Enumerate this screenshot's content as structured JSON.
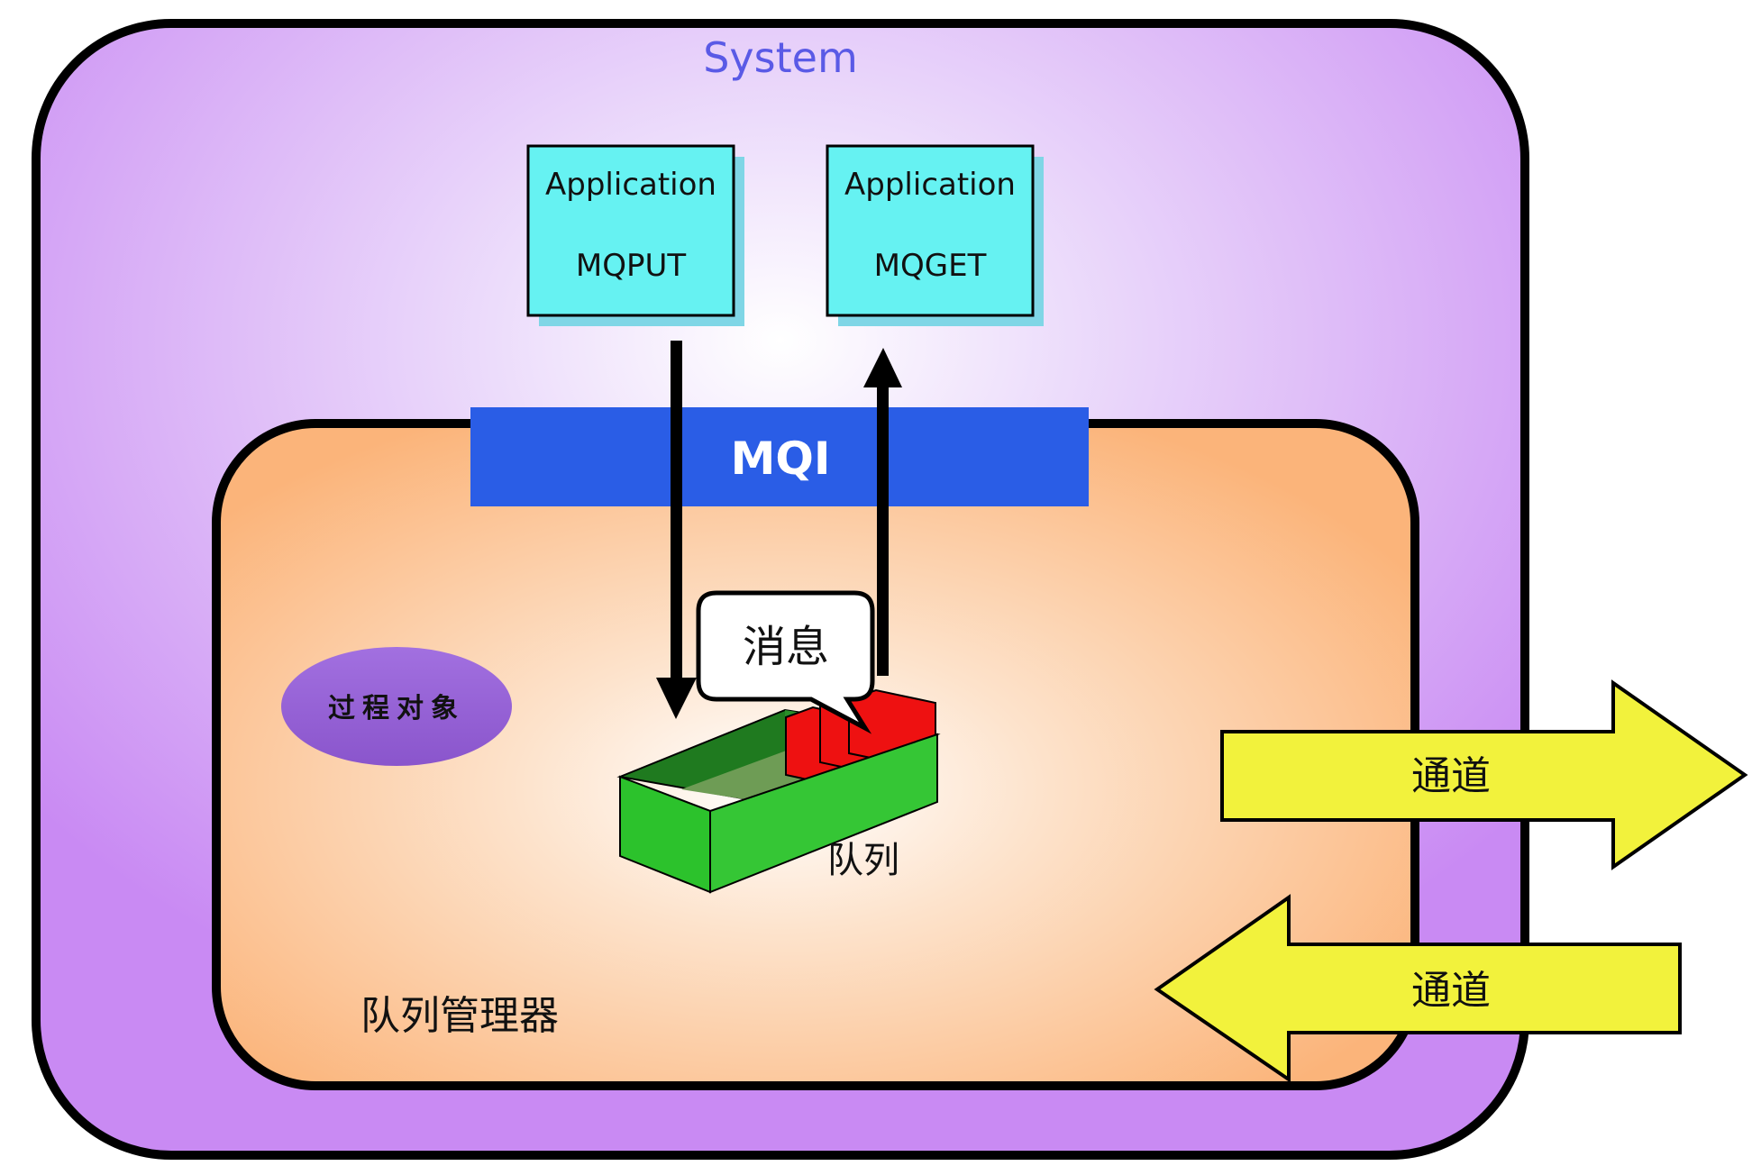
{
  "system": {
    "label": "System"
  },
  "applications": [
    {
      "name": "Application",
      "op": "MQPUT"
    },
    {
      "name": "Application",
      "op": "MQGET"
    }
  ],
  "mqi": {
    "label": "MQI"
  },
  "message": {
    "label": "消息"
  },
  "queue": {
    "label": "队列"
  },
  "process_object": {
    "label": "过程对象"
  },
  "queue_manager": {
    "label": "队列管理器"
  },
  "channels": [
    {
      "label": "通道",
      "direction": "outbound"
    },
    {
      "label": "通道",
      "direction": "inbound"
    }
  ],
  "colors": {
    "system_fill": "#c88af2",
    "queue_manager_fill": "#fbb47a",
    "application_fill": "#66f2f2",
    "mqi_fill": "#2a5de6",
    "process_object_fill": "#9b63d9",
    "channel_fill": "#f2f23c",
    "queue_green": "#35c635",
    "message_red": "#ee1111"
  }
}
